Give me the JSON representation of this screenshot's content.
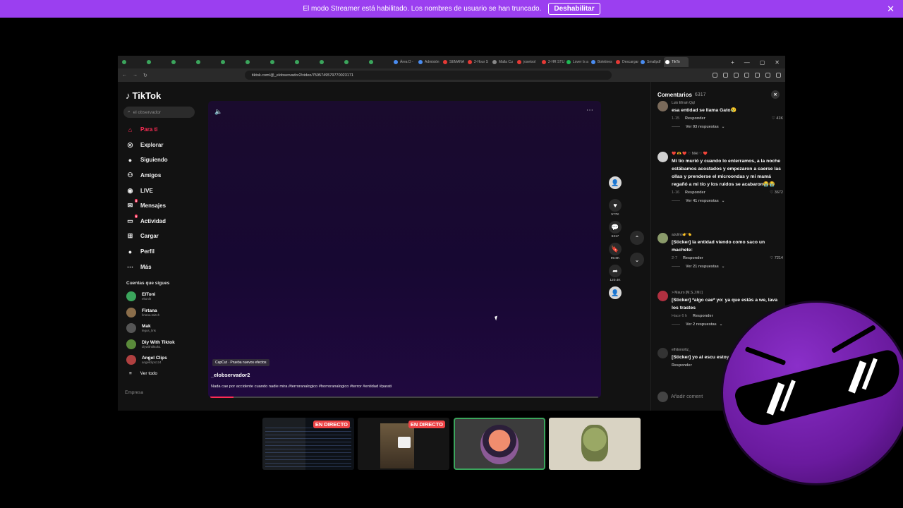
{
  "banner": {
    "message": "El modo Streamer está habilitado. Los nombres de usuario se han truncado.",
    "button": "Deshabilitar",
    "close": "✕"
  },
  "browser": {
    "tabs": [
      {
        "label": "",
        "color": "#3ba55c"
      },
      {
        "label": "",
        "color": "#3ba55c"
      },
      {
        "label": "",
        "color": "#3ba55c"
      },
      {
        "label": "",
        "color": "#3ba55c"
      },
      {
        "label": "",
        "color": "#3ba55c"
      },
      {
        "label": "",
        "color": "#3ba55c"
      },
      {
        "label": "",
        "color": "#3ba55c"
      },
      {
        "label": "",
        "color": "#3ba55c"
      },
      {
        "label": "",
        "color": "#3ba55c"
      },
      {
        "label": "",
        "color": "#3ba55c"
      },
      {
        "label": "",
        "color": "#3ba55c"
      },
      {
        "label": "Área D -",
        "color": "#4a8cf0"
      },
      {
        "label": "Admisión",
        "color": "#4a8cf0"
      },
      {
        "label": "SEMANA",
        "color": "#e53935"
      },
      {
        "label": "2-Hour S",
        "color": "#e53935"
      },
      {
        "label": "Malla Cu",
        "color": "#888888"
      },
      {
        "label": "josetool",
        "color": "#e53935"
      },
      {
        "label": "2-HR STU",
        "color": "#e53935"
      },
      {
        "label": "Lover Is a",
        "color": "#1db954"
      },
      {
        "label": "Boletines",
        "color": "#4a8cf0"
      },
      {
        "label": "Descargar",
        "color": "#e53935"
      },
      {
        "label": "Smallpdf",
        "color": "#4a8cf0"
      },
      {
        "label": "TikTo",
        "color": "#ffffff"
      }
    ],
    "url": "tiktok.com/@_elobservador2/video/7595749579770023171"
  },
  "tiktok": {
    "logo": "TikTok",
    "search_placeholder": "el observador",
    "nav": [
      {
        "label": "Para ti",
        "icon": "home-icon",
        "glyph": "⌂",
        "active": true,
        "badge": ""
      },
      {
        "label": "Explorar",
        "icon": "compass-icon",
        "glyph": "◎",
        "active": false,
        "badge": ""
      },
      {
        "label": "Siguiendo",
        "icon": "following-avatar-icon",
        "glyph": "●",
        "active": false,
        "badge": ""
      },
      {
        "label": "Amigos",
        "icon": "friends-icon",
        "glyph": "⚇",
        "active": false,
        "badge": ""
      },
      {
        "label": "LIVE",
        "icon": "live-icon",
        "glyph": "◉",
        "active": false,
        "badge": ""
      },
      {
        "label": "Mensajes",
        "icon": "messages-icon",
        "glyph": "✉",
        "active": false,
        "badge": "3"
      },
      {
        "label": "Actividad",
        "icon": "activity-icon",
        "glyph": "▭",
        "active": false,
        "badge": "9"
      },
      {
        "label": "Cargar",
        "icon": "upload-icon",
        "glyph": "⊞",
        "active": false,
        "badge": ""
      },
      {
        "label": "Perfil",
        "icon": "profile-avatar-icon",
        "glyph": "●",
        "active": false,
        "badge": ""
      },
      {
        "label": "Más",
        "icon": "more-icon",
        "glyph": "⋯",
        "active": false,
        "badge": ""
      }
    ],
    "following_title": "Cuentas que sigues",
    "accounts": [
      {
        "name": "ElToni",
        "handle": "eltonih",
        "color": "#3ba55c"
      },
      {
        "name": "Firtana",
        "handle": "firtana.twitch",
        "color": "#8a6d4a"
      },
      {
        "name": "Mak",
        "handle": "legus_link",
        "color": "#555555"
      },
      {
        "name": "Diy With Tiktok",
        "handle": "diywithtiktok1",
        "color": "#5a8a3a"
      },
      {
        "name": "Angel Clips",
        "handle": "angelclips124",
        "color": "#b04040"
      }
    ],
    "see_all": "Ver todo",
    "empresa": "Empresa"
  },
  "video": {
    "capcut": "CapCut · Prueba nuevos efectos",
    "author": "_elobservador2",
    "description": "Nada cae por accidente cuando nadie mira.#terroranalogico #horroranalogico #terror #entidad #parati",
    "progress": 0.06
  },
  "actions": {
    "likes": "577K",
    "comments": "6317",
    "saves": "99.8K",
    "shares": "120.4K"
  },
  "comments": {
    "title": "Comentarios",
    "count": "6317",
    "add_placeholder": "Añadir coment",
    "items": [
      {
        "user": "Luis Efrain Qql",
        "text": "esa entidad se llama Gato😢",
        "date": "1-15",
        "reply": "Responder",
        "likes": "♡ 41K",
        "more": "Ver 93 respuestas"
      },
      {
        "user": "❤️ 🫶 ❤️ ♡ MAI ♡ ❤️",
        "text": "Mi tío murió y cuando lo enterramos, a la noche estábamos acostados y empezaron a caerse las ollas y prenderse el microondas y mi mamá regañó a mi tío y los ruidos se acabaron😭😭",
        "date": "1-16",
        "reply": "Responder",
        "likes": "♡ 3672",
        "more": "Ver 41 respuestas"
      },
      {
        "user": "azulino👉👈",
        "text": "[Sticker] la entidad viendo como saco un machete:",
        "date": "2-7",
        "reply": "Responder",
        "likes": "♡ 7214",
        "more": "Ver 21 respuestas"
      },
      {
        "user": "> Mauro [M.S.J.M.I]",
        "text": "[Sticker] *algo cae* yo: ya que estás a we, lava los trastes",
        "date": "Hace 6 h",
        "reply": "Responder",
        "likes": "",
        "more": "Ver 2 respuestas"
      },
      {
        "user": "elhitonortiz_",
        "text": "[Sticker] yo al escu estoy solo en mi ca",
        "date": "",
        "reply": "Responder",
        "likes": "",
        "more": ""
      }
    ]
  },
  "stream": {
    "live_label": "EN DIRECTO"
  }
}
